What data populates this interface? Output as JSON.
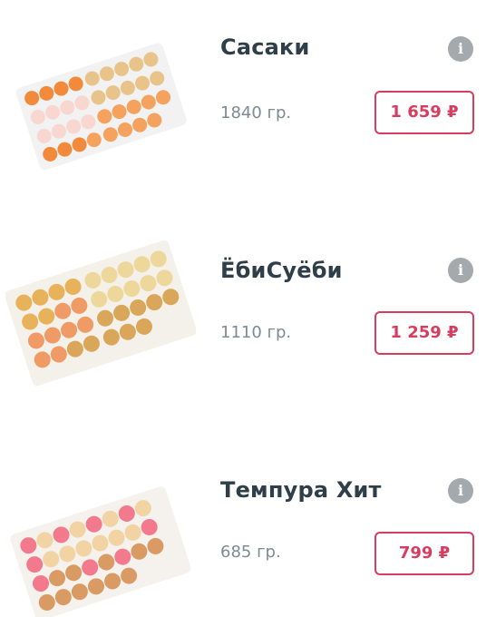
{
  "currency": "₽",
  "colors": {
    "accent": "#d63d5e",
    "title": "#2f3f49",
    "weight": "#7d8b93",
    "info_icon_bg": "#a3a9ad"
  },
  "products": [
    {
      "name": "Сасаки",
      "weight": "1840 гр.",
      "price": "1 659 ₽",
      "info_icon": "info-icon"
    },
    {
      "name": "ЁбиСуёби",
      "weight": "1110 гр.",
      "price": "1 259 ₽",
      "info_icon": "info-icon"
    },
    {
      "name": "Темпура Хит",
      "weight": "685 гр.",
      "price": "799 ₽",
      "info_icon": "info-icon"
    }
  ]
}
